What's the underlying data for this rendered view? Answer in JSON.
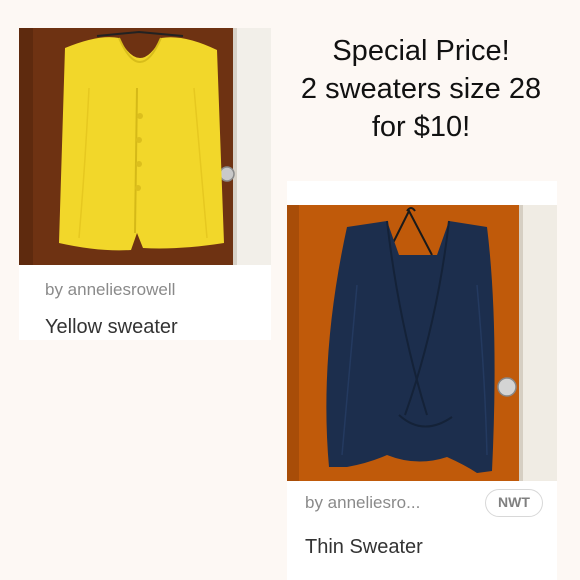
{
  "promo": {
    "line1": "Special Price!",
    "line2": "2 sweaters size 28",
    "line3": "for $10!"
  },
  "listings": [
    {
      "byline": "by anneliesrowell",
      "title": "Yellow sweater",
      "photo_icon": "yellow-cardigan-photo"
    },
    {
      "byline": "by anneliesro...",
      "title": "Thin Sweater",
      "badge": "NWT",
      "photo_icon": "navy-wrap-cardigan-photo"
    }
  ],
  "colors": {
    "page_background": "#fdf8f4",
    "card_background": "#ffffff",
    "yellow_sweater": "#f2d72a",
    "navy_sweater": "#1c2e4d",
    "door_wood": "#7a3b16",
    "text_muted": "#8a8a8a",
    "text_primary": "#333333"
  }
}
